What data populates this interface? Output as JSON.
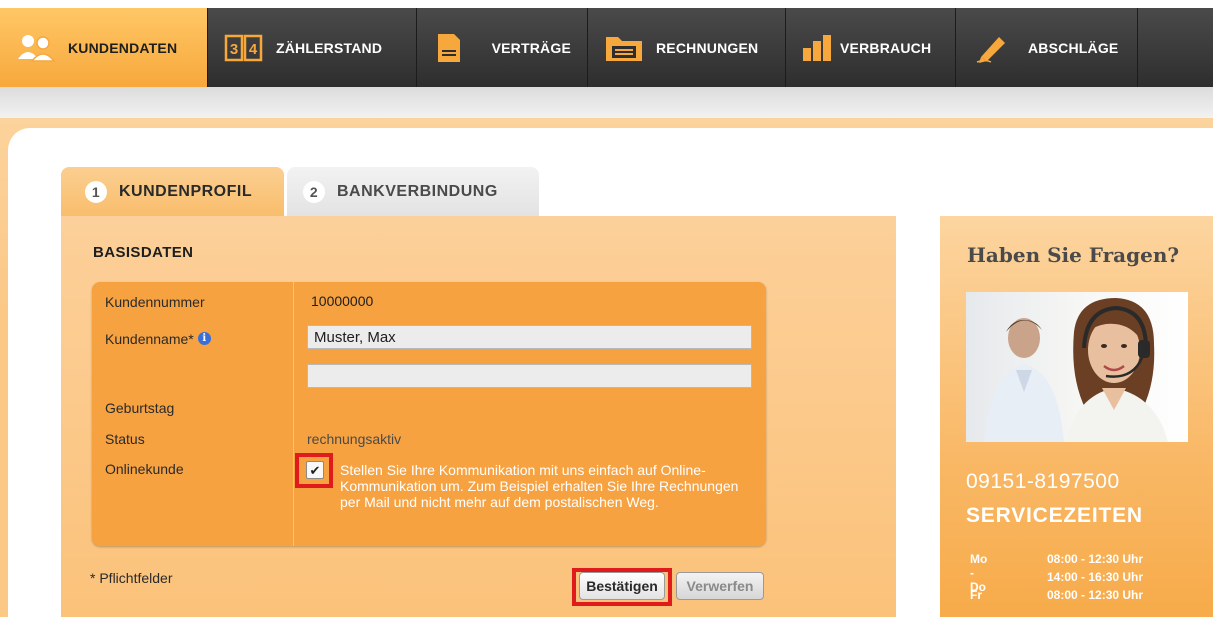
{
  "nav": {
    "items": [
      {
        "label": "KUNDENDATEN",
        "icon": "users-icon",
        "active": true
      },
      {
        "label": "ZÄHLERSTAND",
        "icon": "meter-reading-icon"
      },
      {
        "label": "VERTRÄGE",
        "icon": "contract-document-icon"
      },
      {
        "label": "RECHNUNGEN",
        "icon": "invoice-folder-icon"
      },
      {
        "label": "VERBRAUCH",
        "icon": "consumption-bar-chart-icon"
      },
      {
        "label": "ABSCHLÄGE",
        "icon": "pen-edit-icon"
      }
    ]
  },
  "tabs": [
    {
      "number": "1",
      "label": "KUNDENPROFIL",
      "active": true
    },
    {
      "number": "2",
      "label": "BANKVERBINDUNG",
      "active": false
    }
  ],
  "form": {
    "section_title": "BASISDATEN",
    "customer_number_label": "Kundennummer",
    "customer_number_value": "10000000",
    "customer_name_label": "Kundenname*",
    "customer_name_value": "Muster, Max",
    "customer_name_second_value": "",
    "birthday_label": "Geburtstag",
    "status_label": "Status",
    "status_value": "rechnungsaktiv",
    "online_label": "Onlinekunde",
    "online_checked": true,
    "online_text": "Stellen Sie Ihre Kommunikation mit uns einfach auf Online-Kommunikation um. Zum Beispiel erhalten Sie Ihre Rechnungen per Mail und nicht mehr auf dem postalischen Weg.",
    "required_note": "* Pflichtfelder",
    "confirm_label": "Bestätigen",
    "discard_label": "Verwerfen"
  },
  "side": {
    "title": "Haben Sie Fragen?",
    "phone": "09151-8197500",
    "service_title": "SERVICEZEITEN",
    "hours": [
      {
        "day": "Mo - Do",
        "time": "08:00 - 12:30 Uhr"
      },
      {
        "day": "",
        "time": "14:00 - 16:30 Uhr"
      },
      {
        "day": "Fr",
        "time": "08:00 - 12:30 Uhr"
      }
    ]
  },
  "colors": {
    "accent_orange": "#f7a241",
    "nav_dark": "#2e2e2e",
    "highlight_red": "#e01b1b"
  }
}
